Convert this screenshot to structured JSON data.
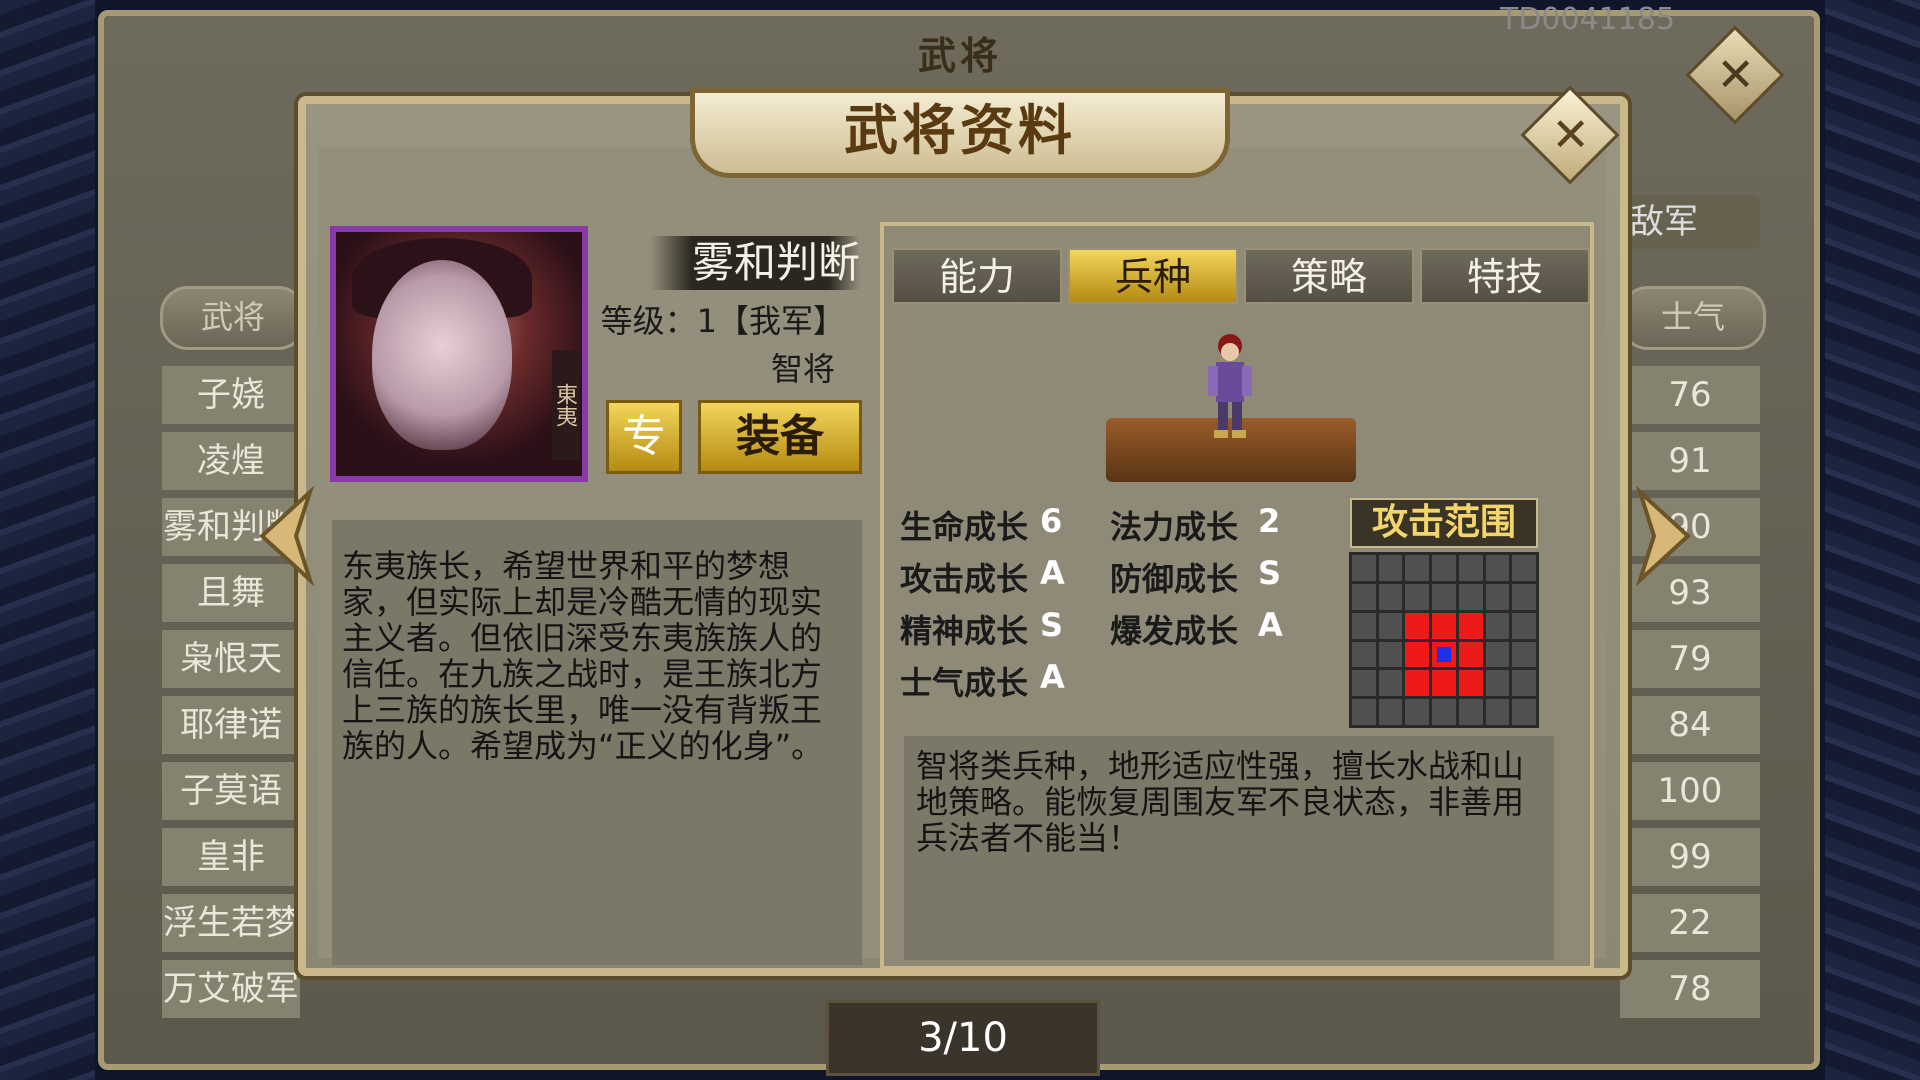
{
  "back_panel": {
    "title": "武将",
    "code": "TD0041185",
    "left_header": "武将",
    "right_tab": "敌军",
    "right_header": "士气",
    "list_names": [
      "子娆",
      "凌煌",
      "雾和判断",
      "且舞",
      "枭恨天",
      "耶律诺",
      "子莫语",
      "皇非",
      "浮生若梦",
      "万艾破军"
    ],
    "list_values": [
      "76",
      "91",
      "90",
      "93",
      "79",
      "84",
      "100",
      "99",
      "22",
      "78"
    ],
    "page_indicator": "3/10"
  },
  "dialog": {
    "title": "武将资料",
    "close_icon": "close-icon"
  },
  "general": {
    "name": "雾和判断",
    "level": "等级：1【我军】",
    "class": "智将",
    "seal": "東夷",
    "exclusive_label": "专",
    "equipment_label": "装备",
    "bio": "东夷族长，希望世界和平的梦想家，但实际上却是冷酷无情的现实主义者。但依旧深受东夷族族人的信任。在九族之战时，是王族北方上三族的族长里，唯一没有背叛王族的人。希望成为“正义的化身”。"
  },
  "tabs": {
    "ability": "能力",
    "troop": "兵种",
    "strategy": "策略",
    "skill": "特技",
    "active": "troop"
  },
  "growth": {
    "hp_label": "生命成长",
    "hp_value": "6",
    "mp_label": "法力成长",
    "mp_value": "2",
    "atk_label": "攻击成长",
    "atk_value": "A",
    "def_label": "防御成长",
    "def_value": "S",
    "spirit_label": "精神成长",
    "spirit_value": "S",
    "burst_label": "爆发成长",
    "burst_value": "A",
    "morale_label": "士气成长",
    "morale_value": "A"
  },
  "attack_range": {
    "title": "攻击范围",
    "cols": 7,
    "rows": 6,
    "red_cells": [
      16,
      17,
      18,
      23,
      25,
      30,
      31,
      32
    ],
    "blue_cells": [
      24
    ]
  },
  "troop_desc": "智将类兵种，地形适应性强，擅长水战和山地策略。能恢复周围友军不良状态，非善用兵法者不能当！",
  "colors": {
    "gold": "#f3d65c",
    "range_red": "#ee1a1a",
    "range_blue": "#1a32ee",
    "portrait_border": "#8a3aa8"
  }
}
